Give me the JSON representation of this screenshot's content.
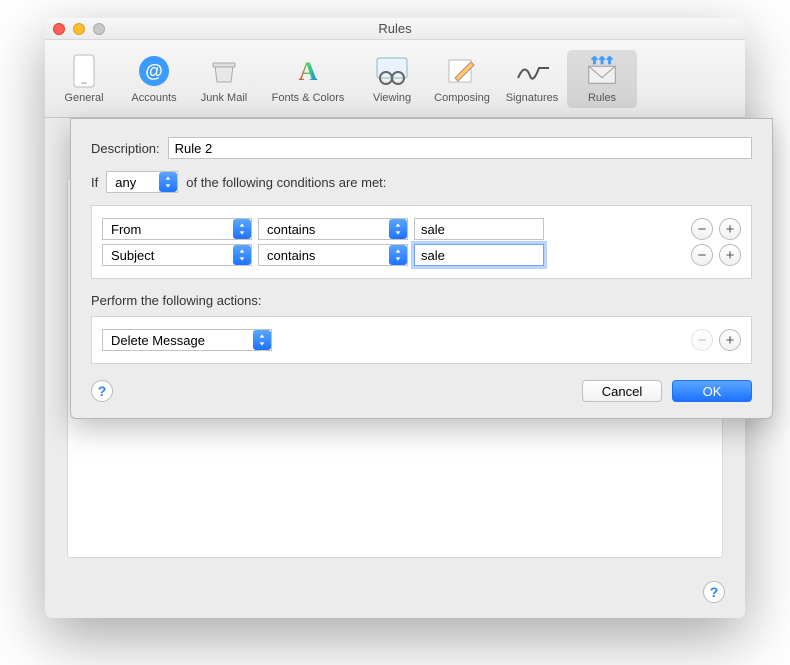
{
  "window": {
    "title": "Rules"
  },
  "toolbar": {
    "items": [
      {
        "label": "General"
      },
      {
        "label": "Accounts"
      },
      {
        "label": "Junk Mail"
      },
      {
        "label": "Fonts & Colors"
      },
      {
        "label": "Viewing"
      },
      {
        "label": "Composing"
      },
      {
        "label": "Signatures"
      },
      {
        "label": "Rules"
      }
    ]
  },
  "sheet": {
    "description_label": "Description:",
    "description_value": "Rule 2",
    "if_prefix": "If",
    "if_mode": "any",
    "if_suffix": "of the following conditions are met:",
    "conditions": [
      {
        "field": "From",
        "op": "contains",
        "value": "sale",
        "focused": false
      },
      {
        "field": "Subject",
        "op": "contains",
        "value": "sale",
        "focused": true
      }
    ],
    "actions_label": "Perform the following actions:",
    "actions": [
      {
        "action": "Delete Message",
        "minus_disabled": true
      }
    ],
    "cancel_label": "Cancel",
    "ok_label": "OK",
    "help_glyph": "?"
  }
}
